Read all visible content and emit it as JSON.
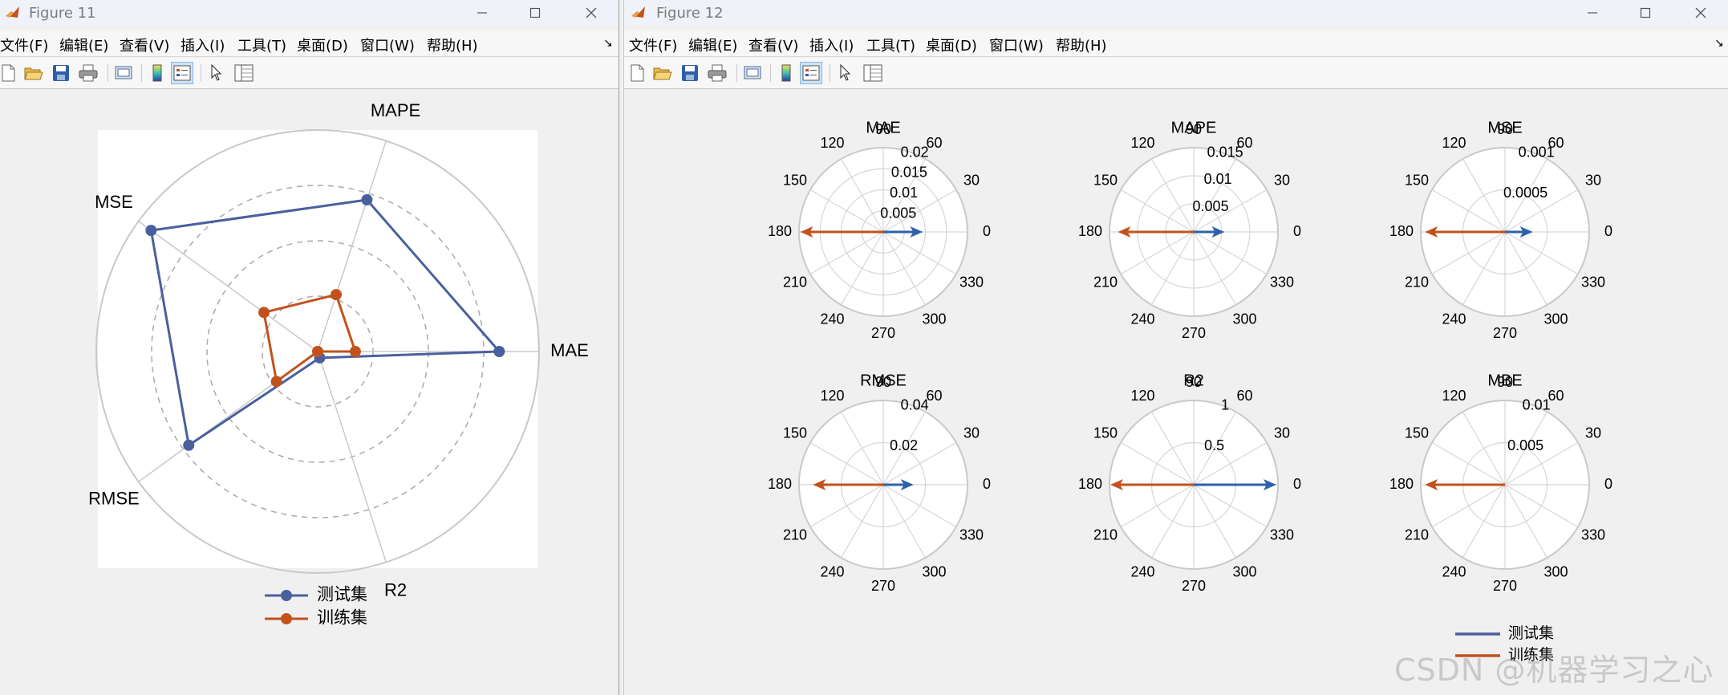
{
  "colors": {
    "test": "#4a609e",
    "train": "#c2521c",
    "grid": "#c9c9c9",
    "grid_dash": "#a9a9a9",
    "arrow_test": "#2e62a8"
  },
  "windows": [
    {
      "title": "Figure 11",
      "menu": [
        "文件(F)",
        "编辑(E)",
        "查看(V)",
        "插入(I)",
        "工具(T)",
        "桌面(D)",
        "窗口(W)",
        "帮助(H)"
      ],
      "toolbar": [
        "new-file-icon",
        "open-folder-icon",
        "save-icon",
        "print-icon",
        "print-preview-icon",
        "colorbar-icon",
        "legend-icon",
        "pointer-icon",
        "property-inspector-icon"
      ]
    },
    {
      "title": "Figure 12",
      "menu": [
        "文件(F)",
        "编辑(E)",
        "查看(V)",
        "插入(I)",
        "工具(T)",
        "桌面(D)",
        "窗口(W)",
        "帮助(H)"
      ],
      "toolbar": [
        "new-file-icon",
        "open-folder-icon",
        "save-icon",
        "print-icon",
        "print-preview-icon",
        "colorbar-icon",
        "legend-icon",
        "pointer-icon",
        "property-inspector-icon"
      ]
    }
  ],
  "chart_data": [
    {
      "type": "radar",
      "axes": [
        "MAE",
        "MAPE",
        "MSE",
        "RMSE",
        "R2"
      ],
      "rlim": [
        0,
        1
      ],
      "grid": true,
      "legend": "bottom",
      "series": [
        {
          "name": "测试集",
          "values": [
            0.82,
            0.72,
            0.93,
            0.72,
            0.03
          ]
        },
        {
          "name": "训练集",
          "values": [
            0.17,
            0.27,
            0.3,
            0.23,
            0.0
          ]
        }
      ]
    },
    {
      "type": "compass",
      "legend": "bottom-right",
      "legend_entries": [
        "测试集",
        "训练集"
      ],
      "theta_ticks": [
        "0",
        "30",
        "60",
        "90",
        "120",
        "150",
        "180",
        "210",
        "240",
        "270",
        "300",
        "330"
      ],
      "subplots": [
        {
          "title": "MAE",
          "r_ticks": [
            "0.005",
            "0.01",
            "0.015",
            "0.02"
          ],
          "rmax": 0.02,
          "test": 0.0094,
          "train": -0.0197
        },
        {
          "title": "MAPE",
          "r_ticks": [
            "0.005",
            "0.01",
            "0.015"
          ],
          "rmax": 0.015,
          "test": 0.0055,
          "train": -0.0135
        },
        {
          "title": "MSE",
          "r_ticks": [
            "0.0005",
            "0.001"
          ],
          "rmax": 0.001,
          "test": 0.00033,
          "train": -0.00095
        },
        {
          "title": "RMSE",
          "r_ticks": [
            "0.02",
            "0.04"
          ],
          "rmax": 0.04,
          "test": 0.0144,
          "train": -0.0334
        },
        {
          "title": "R2",
          "r_ticks": [
            "0.5",
            "1"
          ],
          "rmax": 1,
          "test": 0.98,
          "train": -0.99
        },
        {
          "title": "MBE",
          "r_ticks": [
            "0.005",
            "0.01"
          ],
          "rmax": 0.01,
          "test": 0,
          "train": -0.0095
        }
      ]
    }
  ],
  "watermark": "CSDN @机器学习之心"
}
